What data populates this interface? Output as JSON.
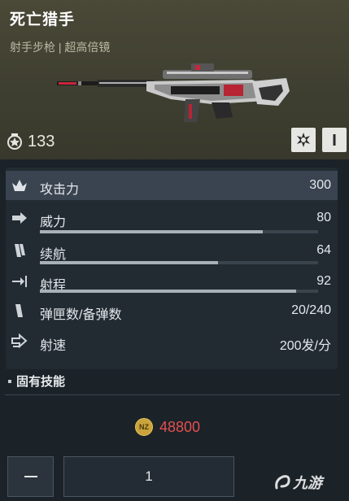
{
  "weapon": {
    "name": "死亡猎手",
    "type": "射手步枪",
    "separator": "|",
    "scope": "超高倍镜",
    "rank_value": "133"
  },
  "header_buttons": [
    {
      "icon": "starburst-icon"
    },
    {
      "icon": "bar-icon"
    }
  ],
  "stats": [
    {
      "label": "攻击力",
      "value": "300",
      "icon": "crown-icon",
      "highlight": true,
      "bar": null
    },
    {
      "label": "威力",
      "value": "80",
      "icon": "arrow-right-icon",
      "highlight": false,
      "bar": 0.8
    },
    {
      "label": "续航",
      "value": "64",
      "icon": "magazine-icon",
      "highlight": false,
      "bar": 0.64
    },
    {
      "label": "射程",
      "value": "92",
      "icon": "range-arrow-icon",
      "highlight": false,
      "bar": 0.92
    },
    {
      "label": "弹匣数/备弹数",
      "value": "20/240",
      "icon": "ammo-icon",
      "highlight": false,
      "bar": null
    },
    {
      "label": "射速",
      "value": "200发/分",
      "icon": "fire-rate-icon",
      "highlight": false,
      "bar": null
    }
  ],
  "skills": {
    "label": "固有技能"
  },
  "purchase": {
    "currency_icon": "NZ",
    "price": "48800",
    "quantity": "1",
    "minus_label": "—"
  },
  "watermark": {
    "text": "九游"
  },
  "colors": {
    "header_bg": "#3f3f31",
    "panel_bg": "#222b32",
    "highlight_row": "#3a4450",
    "price_red": "#e35050",
    "coin_gold": "#c9a33c"
  }
}
